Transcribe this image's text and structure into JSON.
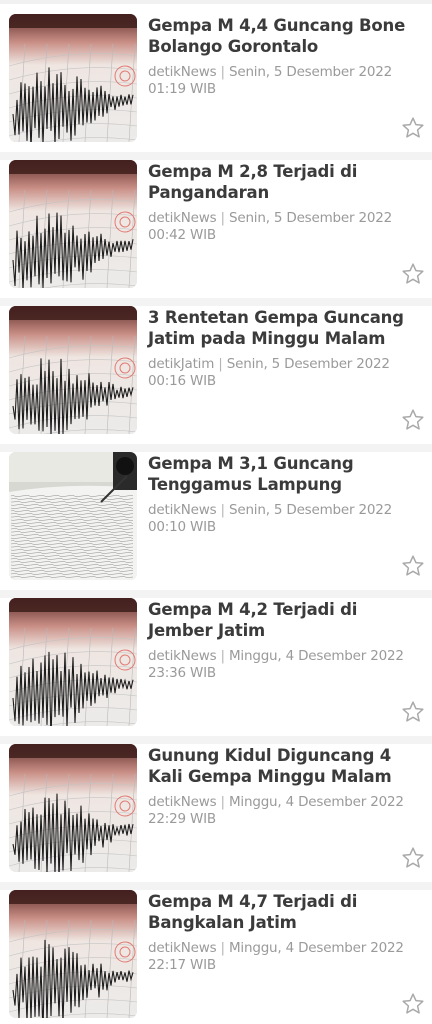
{
  "articles": [
    {
      "title": "Gempa M 4,4 Guncang Bone Bolango Gorontalo",
      "source": "detikNews",
      "date": "Senin, 5 Desember 2022",
      "time": "01:19 WIB",
      "thumbnail_icon": "seismograph-image"
    },
    {
      "title": "Gempa M 2,8 Terjadi di Pangandaran",
      "source": "detikNews",
      "date": "Senin, 5 Desember 2022",
      "time": "00:42 WIB",
      "thumbnail_icon": "seismograph-image"
    },
    {
      "title": "3 Rentetan Gempa Guncang Jatim pada Minggu Malam",
      "source": "detikJatim",
      "date": "Senin, 5 Desember 2022",
      "time": "00:16 WIB",
      "thumbnail_icon": "seismograph-image"
    },
    {
      "title": "Gempa M 3,1 Guncang Tenggamus Lampung",
      "source": "detikNews",
      "date": "Senin, 5 Desember 2022",
      "time": "00:10 WIB",
      "thumbnail_icon": "seismograph-drum-image"
    },
    {
      "title": "Gempa M 4,2 Terjadi di Jember Jatim",
      "source": "detikNews",
      "date": "Minggu, 4 Desember 2022",
      "time": "23:36 WIB",
      "thumbnail_icon": "seismograph-image"
    },
    {
      "title": "Gunung Kidul Diguncang 4 Kali Gempa Minggu Malam",
      "source": "detikNews",
      "date": "Minggu, 4 Desember 2022",
      "time": "22:29 WIB",
      "thumbnail_icon": "seismograph-image"
    },
    {
      "title": "Gempa M 4,7 Terjadi di Bangkalan Jatim",
      "source": "detikNews",
      "date": "Minggu, 4 Desember 2022",
      "time": "22:17 WIB",
      "thumbnail_icon": "seismograph-image"
    }
  ],
  "meta_separator": "|",
  "bookmark_icon": "star-outline-icon",
  "colors": {
    "title": "#3b3b3b",
    "meta": "#9a9a9a",
    "star": "#a9a9a9",
    "divider": "#f3f3f3"
  }
}
